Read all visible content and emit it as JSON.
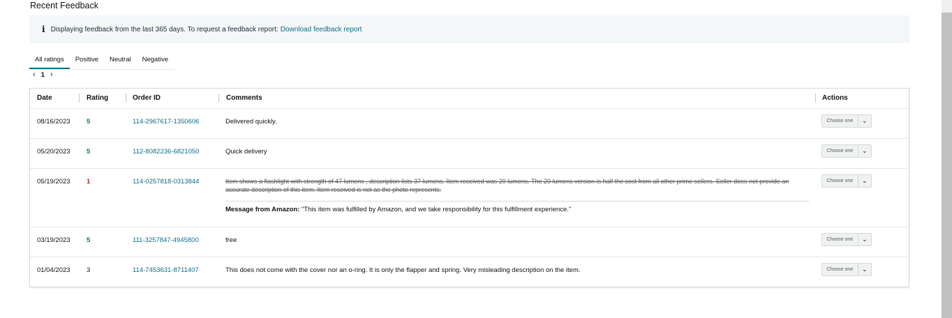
{
  "section_title": "Recent Feedback",
  "info": {
    "icon": "info-icon",
    "text": "Displaying feedback from the last 365 days. To request a feedback report:",
    "link": "Download feedback report"
  },
  "tabs": [
    {
      "label": "All ratings",
      "active": true
    },
    {
      "label": "Positive",
      "active": false
    },
    {
      "label": "Neutral",
      "active": false
    },
    {
      "label": "Negative",
      "active": false
    }
  ],
  "pager": {
    "prev": "‹",
    "page": "1",
    "next": "›"
  },
  "table": {
    "headers": {
      "date": "Date",
      "rating": "Rating",
      "order_id": "Order ID",
      "comments": "Comments",
      "actions": "Actions"
    },
    "rows": [
      {
        "date": "08/16/2023",
        "rating": "5",
        "order_id": "114-2967617-1350606",
        "comment": "Delivered quickly.",
        "action": "Choose one"
      },
      {
        "date": "05/20/2023",
        "rating": "5",
        "order_id": "112-8082236-6821050",
        "comment": "Quick delivery",
        "action": "Choose one"
      },
      {
        "date": "05/19/2023",
        "rating": "1",
        "order_id": "114-0257818-0313844",
        "comment": "Item shows a flashlight with strength of 47 lumens , description lists 37 lumens. Item received was 20 lumens. The 20 lumens version is half the cost from all other prime sellers. Seller does not provide an accurate description of this item. Item received is not as the photo represents.",
        "amazon_label": "Message from Amazon:",
        "amazon_message": "\"This item was fulfilled by Amazon, and we take responsibility for this fulfillment experience.\"",
        "action": "Choose one"
      },
      {
        "date": "03/19/2023",
        "rating": "5",
        "order_id": "111-3257847-4945800",
        "comment": "free",
        "action": "Choose one"
      },
      {
        "date": "01/04/2023",
        "rating": "3",
        "order_id": "114-7453631-8711407",
        "comment": "This does not come with the cover nor an o-ring. It is only the flapper and spring. Very misleading description on the item.",
        "action": "Choose one"
      }
    ]
  },
  "colors": {
    "link": "#0f6d8a",
    "rating_good": "#067d62",
    "rating_bad": "#b12704",
    "info_bg": "#f3f7f7"
  }
}
